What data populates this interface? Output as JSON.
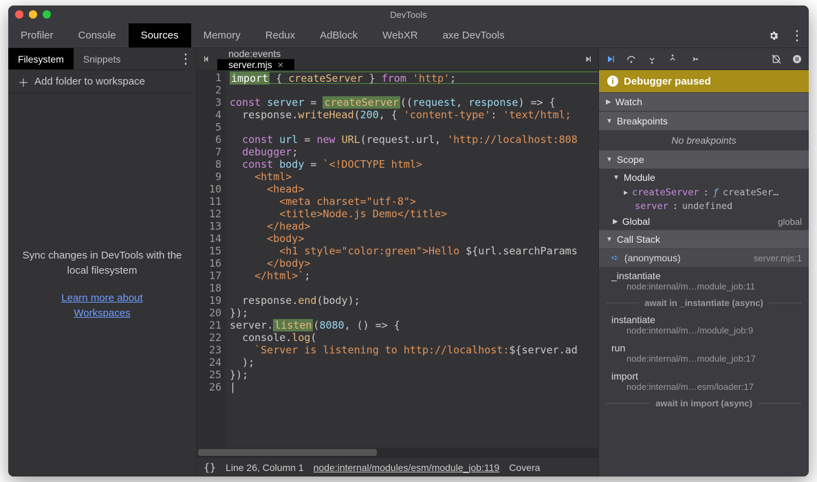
{
  "window": {
    "title": "DevTools"
  },
  "mainTabs": [
    "Profiler",
    "Console",
    "Sources",
    "Memory",
    "Redux",
    "AdBlock",
    "WebXR",
    "axe DevTools"
  ],
  "mainTabActive": "Sources",
  "leftTabs": [
    "Filesystem",
    "Snippets"
  ],
  "leftTabActive": "Filesystem",
  "addFolder": "Add folder to workspace",
  "syncText": "Sync changes in DevTools with the local filesystem",
  "syncLink1": "Learn more about",
  "syncLink2": "Workspaces",
  "fileTabs": [
    {
      "label": "node:events",
      "active": false
    },
    {
      "label": "server.mjs",
      "active": true
    }
  ],
  "code": {
    "lines": 26,
    "src": [
      {
        "n": 1,
        "tokens": [
          {
            "t": "import",
            "c": "imp-hl"
          },
          {
            "t": " { ",
            "c": "k-punc"
          },
          {
            "t": "createServer",
            "c": "k-func"
          },
          {
            "t": " } ",
            "c": "k-punc"
          },
          {
            "t": "from",
            "c": "k-keyword"
          },
          {
            "t": " ",
            "c": ""
          },
          {
            "t": "'http'",
            "c": "k-str"
          },
          {
            "t": ";",
            "c": "k-punc"
          }
        ]
      },
      {
        "n": 2,
        "tokens": []
      },
      {
        "n": 3,
        "tokens": [
          {
            "t": "const",
            "c": "k-keyword"
          },
          {
            "t": " ",
            "c": ""
          },
          {
            "t": "server",
            "c": "k-ident"
          },
          {
            "t": " = ",
            "c": "k-punc"
          },
          {
            "t": "createServer",
            "c": "green-hl k-func"
          },
          {
            "t": "((",
            "c": "k-punc"
          },
          {
            "t": "request",
            "c": "k-ident"
          },
          {
            "t": ", ",
            "c": "k-punc"
          },
          {
            "t": "response",
            "c": "k-ident"
          },
          {
            "t": ") => {",
            "c": "k-punc"
          }
        ]
      },
      {
        "n": 4,
        "tokens": [
          {
            "t": "  ",
            "c": ""
          },
          {
            "t": "response",
            "c": "k-prop"
          },
          {
            "t": ".",
            "c": "k-punc"
          },
          {
            "t": "writeHead",
            "c": "k-func"
          },
          {
            "t": "(",
            "c": "k-punc"
          },
          {
            "t": "200",
            "c": "k-num"
          },
          {
            "t": ", { ",
            "c": "k-punc"
          },
          {
            "t": "'content-type'",
            "c": "k-str"
          },
          {
            "t": ": ",
            "c": "k-punc"
          },
          {
            "t": "'text/html;",
            "c": "k-str"
          }
        ]
      },
      {
        "n": 5,
        "tokens": []
      },
      {
        "n": 6,
        "tokens": [
          {
            "t": "  ",
            "c": ""
          },
          {
            "t": "const",
            "c": "k-keyword"
          },
          {
            "t": " ",
            "c": ""
          },
          {
            "t": "url",
            "c": "k-ident"
          },
          {
            "t": " = ",
            "c": "k-punc"
          },
          {
            "t": "new",
            "c": "k-keyword"
          },
          {
            "t": " ",
            "c": ""
          },
          {
            "t": "URL",
            "c": "k-func"
          },
          {
            "t": "(",
            "c": "k-punc"
          },
          {
            "t": "request",
            "c": "k-prop"
          },
          {
            "t": ".",
            "c": "k-punc"
          },
          {
            "t": "url",
            "c": "k-prop"
          },
          {
            "t": ", ",
            "c": "k-punc"
          },
          {
            "t": "'http://localhost:808",
            "c": "k-str"
          }
        ]
      },
      {
        "n": 7,
        "tokens": [
          {
            "t": "  ",
            "c": ""
          },
          {
            "t": "debugger",
            "c": "k-keyword"
          },
          {
            "t": ";",
            "c": "k-punc"
          }
        ]
      },
      {
        "n": 8,
        "tokens": [
          {
            "t": "  ",
            "c": ""
          },
          {
            "t": "const",
            "c": "k-keyword"
          },
          {
            "t": " ",
            "c": ""
          },
          {
            "t": "body",
            "c": "k-ident"
          },
          {
            "t": " = ",
            "c": "k-punc"
          },
          {
            "t": "`<!DOCTYPE html>",
            "c": "k-str"
          }
        ]
      },
      {
        "n": 9,
        "tokens": [
          {
            "t": "    <html>",
            "c": "k-str"
          }
        ]
      },
      {
        "n": 10,
        "tokens": [
          {
            "t": "      <head>",
            "c": "k-str"
          }
        ]
      },
      {
        "n": 11,
        "tokens": [
          {
            "t": "        <meta charset=\"utf-8\">",
            "c": "k-str"
          }
        ]
      },
      {
        "n": 12,
        "tokens": [
          {
            "t": "        <title>Node.js Demo</title>",
            "c": "k-str"
          }
        ]
      },
      {
        "n": 13,
        "tokens": [
          {
            "t": "      </head>",
            "c": "k-str"
          }
        ]
      },
      {
        "n": 14,
        "tokens": [
          {
            "t": "      <body>",
            "c": "k-str"
          }
        ]
      },
      {
        "n": 15,
        "tokens": [
          {
            "t": "        <h1 style=\"color:green\">Hello ",
            "c": "k-str"
          },
          {
            "t": "${",
            "c": "k-punc"
          },
          {
            "t": "url",
            "c": "k-prop"
          },
          {
            "t": ".",
            "c": "k-punc"
          },
          {
            "t": "searchParams",
            "c": "k-prop"
          }
        ]
      },
      {
        "n": 16,
        "tokens": [
          {
            "t": "      </body>",
            "c": "k-str"
          }
        ]
      },
      {
        "n": 17,
        "tokens": [
          {
            "t": "    </html>`",
            "c": "k-str"
          },
          {
            "t": ";",
            "c": "k-punc"
          }
        ]
      },
      {
        "n": 18,
        "tokens": []
      },
      {
        "n": 19,
        "tokens": [
          {
            "t": "  ",
            "c": ""
          },
          {
            "t": "response",
            "c": "k-prop"
          },
          {
            "t": ".",
            "c": "k-punc"
          },
          {
            "t": "end",
            "c": "k-func"
          },
          {
            "t": "(",
            "c": "k-punc"
          },
          {
            "t": "body",
            "c": "k-prop"
          },
          {
            "t": ");",
            "c": "k-punc"
          }
        ]
      },
      {
        "n": 20,
        "tokens": [
          {
            "t": "});",
            "c": "k-punc"
          }
        ]
      },
      {
        "n": 21,
        "tokens": [
          {
            "t": "server",
            "c": "k-prop"
          },
          {
            "t": ".",
            "c": "k-punc"
          },
          {
            "t": "listen",
            "c": "green-hl k-func"
          },
          {
            "t": "(",
            "c": "k-punc"
          },
          {
            "t": "8080",
            "c": "k-num"
          },
          {
            "t": ", () => {",
            "c": "k-punc"
          }
        ]
      },
      {
        "n": 22,
        "tokens": [
          {
            "t": "  ",
            "c": ""
          },
          {
            "t": "console",
            "c": "k-prop"
          },
          {
            "t": ".",
            "c": "k-punc"
          },
          {
            "t": "log",
            "c": "k-func"
          },
          {
            "t": "(",
            "c": "k-punc"
          }
        ]
      },
      {
        "n": 23,
        "tokens": [
          {
            "t": "    ",
            "c": ""
          },
          {
            "t": "`Server is listening to http://localhost:",
            "c": "k-str"
          },
          {
            "t": "${",
            "c": "k-punc"
          },
          {
            "t": "server",
            "c": "k-prop"
          },
          {
            "t": ".",
            "c": "k-punc"
          },
          {
            "t": "ad",
            "c": "k-prop"
          }
        ]
      },
      {
        "n": 24,
        "tokens": [
          {
            "t": "  );",
            "c": "k-punc"
          }
        ]
      },
      {
        "n": 25,
        "tokens": [
          {
            "t": "});",
            "c": "k-punc"
          }
        ]
      },
      {
        "n": 26,
        "tokens": [
          {
            "t": "|",
            "c": "k-punc"
          }
        ]
      }
    ]
  },
  "status": {
    "cursor": "Line 26, Column 1",
    "link": "node:internal/modules/esm/module_job:119",
    "extra": "Covera"
  },
  "debugger": {
    "paused": "Debugger paused",
    "watch": "Watch",
    "breakpoints": "Breakpoints",
    "noBreakpoints": "No breakpoints",
    "scope": "Scope",
    "module": "Module",
    "scopeItems": [
      {
        "name": "createServer",
        "type": "ƒ",
        "val": "createSer…"
      },
      {
        "name": "server",
        "type": "",
        "val": "undefined"
      }
    ],
    "global": "Global",
    "globalVal": "global",
    "callstack": "Call Stack",
    "frames": [
      {
        "name": "(anonymous)",
        "loc": "server.mjs:1",
        "current": true
      },
      {
        "name": "_instantiate",
        "loc": "node:internal/m…module_job:11"
      },
      {
        "async": "await in _instantiate (async)"
      },
      {
        "name": "instantiate",
        "loc": "node:internal/m…/module_job:9"
      },
      {
        "name": "run",
        "loc": "node:internal/m…module_job:17"
      },
      {
        "name": "import",
        "loc": "node:internal/m…esm/loader:17"
      },
      {
        "async": "await in import (async)"
      }
    ]
  }
}
